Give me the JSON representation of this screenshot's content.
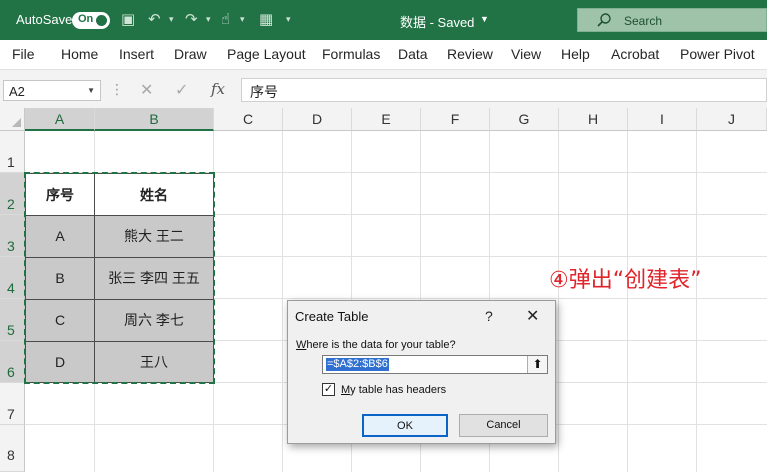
{
  "titlebar": {
    "autosave_label": "AutoSave",
    "autosave_state": "On",
    "doc_title": "数据 - Saved",
    "search_placeholder": "Search",
    "accent_color": "#217346"
  },
  "ribbon": {
    "tabs": [
      "File",
      "Home",
      "Insert",
      "Draw",
      "Page Layout",
      "Formulas",
      "Data",
      "Review",
      "View",
      "Help",
      "Acrobat",
      "Power Pivot"
    ]
  },
  "formula_bar": {
    "name_box": "A2",
    "formula": "序号",
    "icons": [
      "cancel-icon",
      "enter-icon",
      "insert-function-icon"
    ]
  },
  "grid": {
    "columns": [
      "A",
      "B",
      "C",
      "D",
      "E",
      "F",
      "G",
      "H",
      "I",
      "J"
    ],
    "rows": [
      "1",
      "2",
      "3",
      "4",
      "5",
      "6",
      "7",
      "8"
    ],
    "table": {
      "headers": [
        "序号",
        "姓名"
      ],
      "rows": [
        [
          "A",
          "熊大 王二"
        ],
        [
          "B",
          "张三 李四 王五"
        ],
        [
          "C",
          "周六 李七"
        ],
        [
          "D",
          "王八"
        ]
      ]
    }
  },
  "annotation": {
    "text": "④弹出“创建表”",
    "color": "#e0242b"
  },
  "dialog": {
    "title": "Create Table",
    "help": "?",
    "close": "✕",
    "prompt_ul": "W",
    "prompt_rest": "here is the data for your table?",
    "range": "=$A$2:$B$6",
    "checkbox_checked": true,
    "checkbox_ul": "M",
    "checkbox_rest": "y table has headers",
    "ok_label": "OK",
    "cancel_label": "Cancel"
  }
}
